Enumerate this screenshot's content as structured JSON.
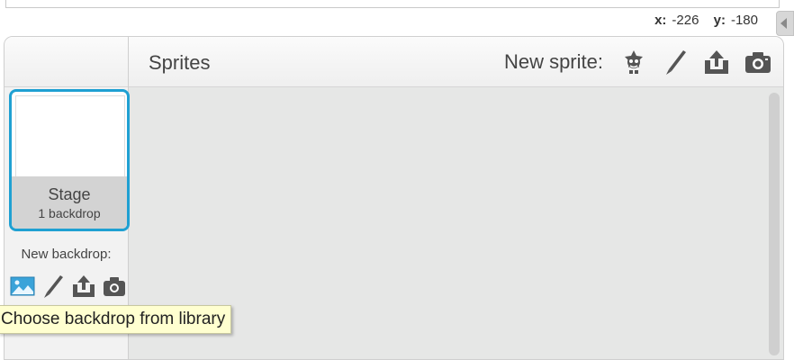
{
  "coords": {
    "x_label": "x:",
    "x_value": "-226",
    "y_label": "y:",
    "y_value": "-180"
  },
  "sprites_header": {
    "title": "Sprites",
    "new_sprite_label": "New sprite:",
    "icons": [
      "sprite-library-icon",
      "paint-brush-icon",
      "upload-icon",
      "camera-icon"
    ]
  },
  "stage_tile": {
    "name": "Stage",
    "backdrop_count": "1 backdrop"
  },
  "new_backdrop": {
    "label": "New backdrop:",
    "icons": [
      "backdrop-library-icon",
      "paint-brush-icon",
      "upload-icon",
      "camera-icon"
    ]
  },
  "tooltip": {
    "text": "Choose backdrop from library"
  },
  "colors": {
    "selection_blue": "#1fa0d2",
    "tooltip_bg": "#ffffd0",
    "panel_bg": "#e6e7e6"
  }
}
